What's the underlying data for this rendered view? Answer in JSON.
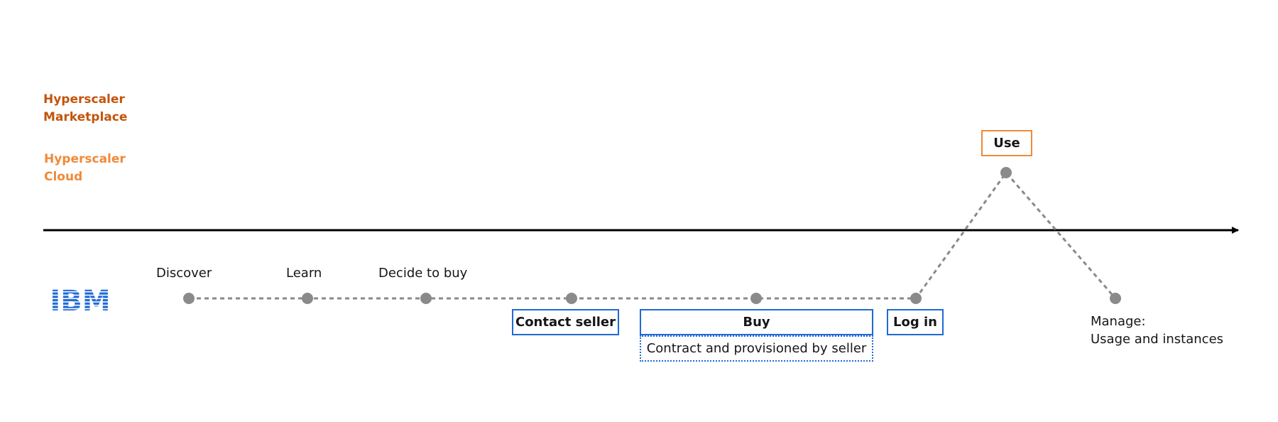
{
  "lanes": {
    "marketplace": {
      "line1": "Hyperscaler",
      "line2": "Marketplace",
      "color": "#c4540b"
    },
    "cloud": {
      "line1": "Hyperscaler",
      "line2": "Cloud",
      "color": "#ef8a3a"
    }
  },
  "logo": {
    "text": "IBM",
    "color": "#1f6ad6"
  },
  "steps": {
    "discover": "Discover",
    "learn": "Learn",
    "decide": "Decide to buy",
    "contact_seller": "Contact seller",
    "buy": "Buy",
    "contract": "Contract and provisioned by seller",
    "login": "Log in",
    "use": "Use",
    "manage_line1": "Manage:",
    "manage_line2": "Usage and instances"
  },
  "colors": {
    "axis": "#000000",
    "node": "#8a8a8a",
    "box_blue": "#1f6ad6",
    "box_orange": "#ef8a3a"
  }
}
